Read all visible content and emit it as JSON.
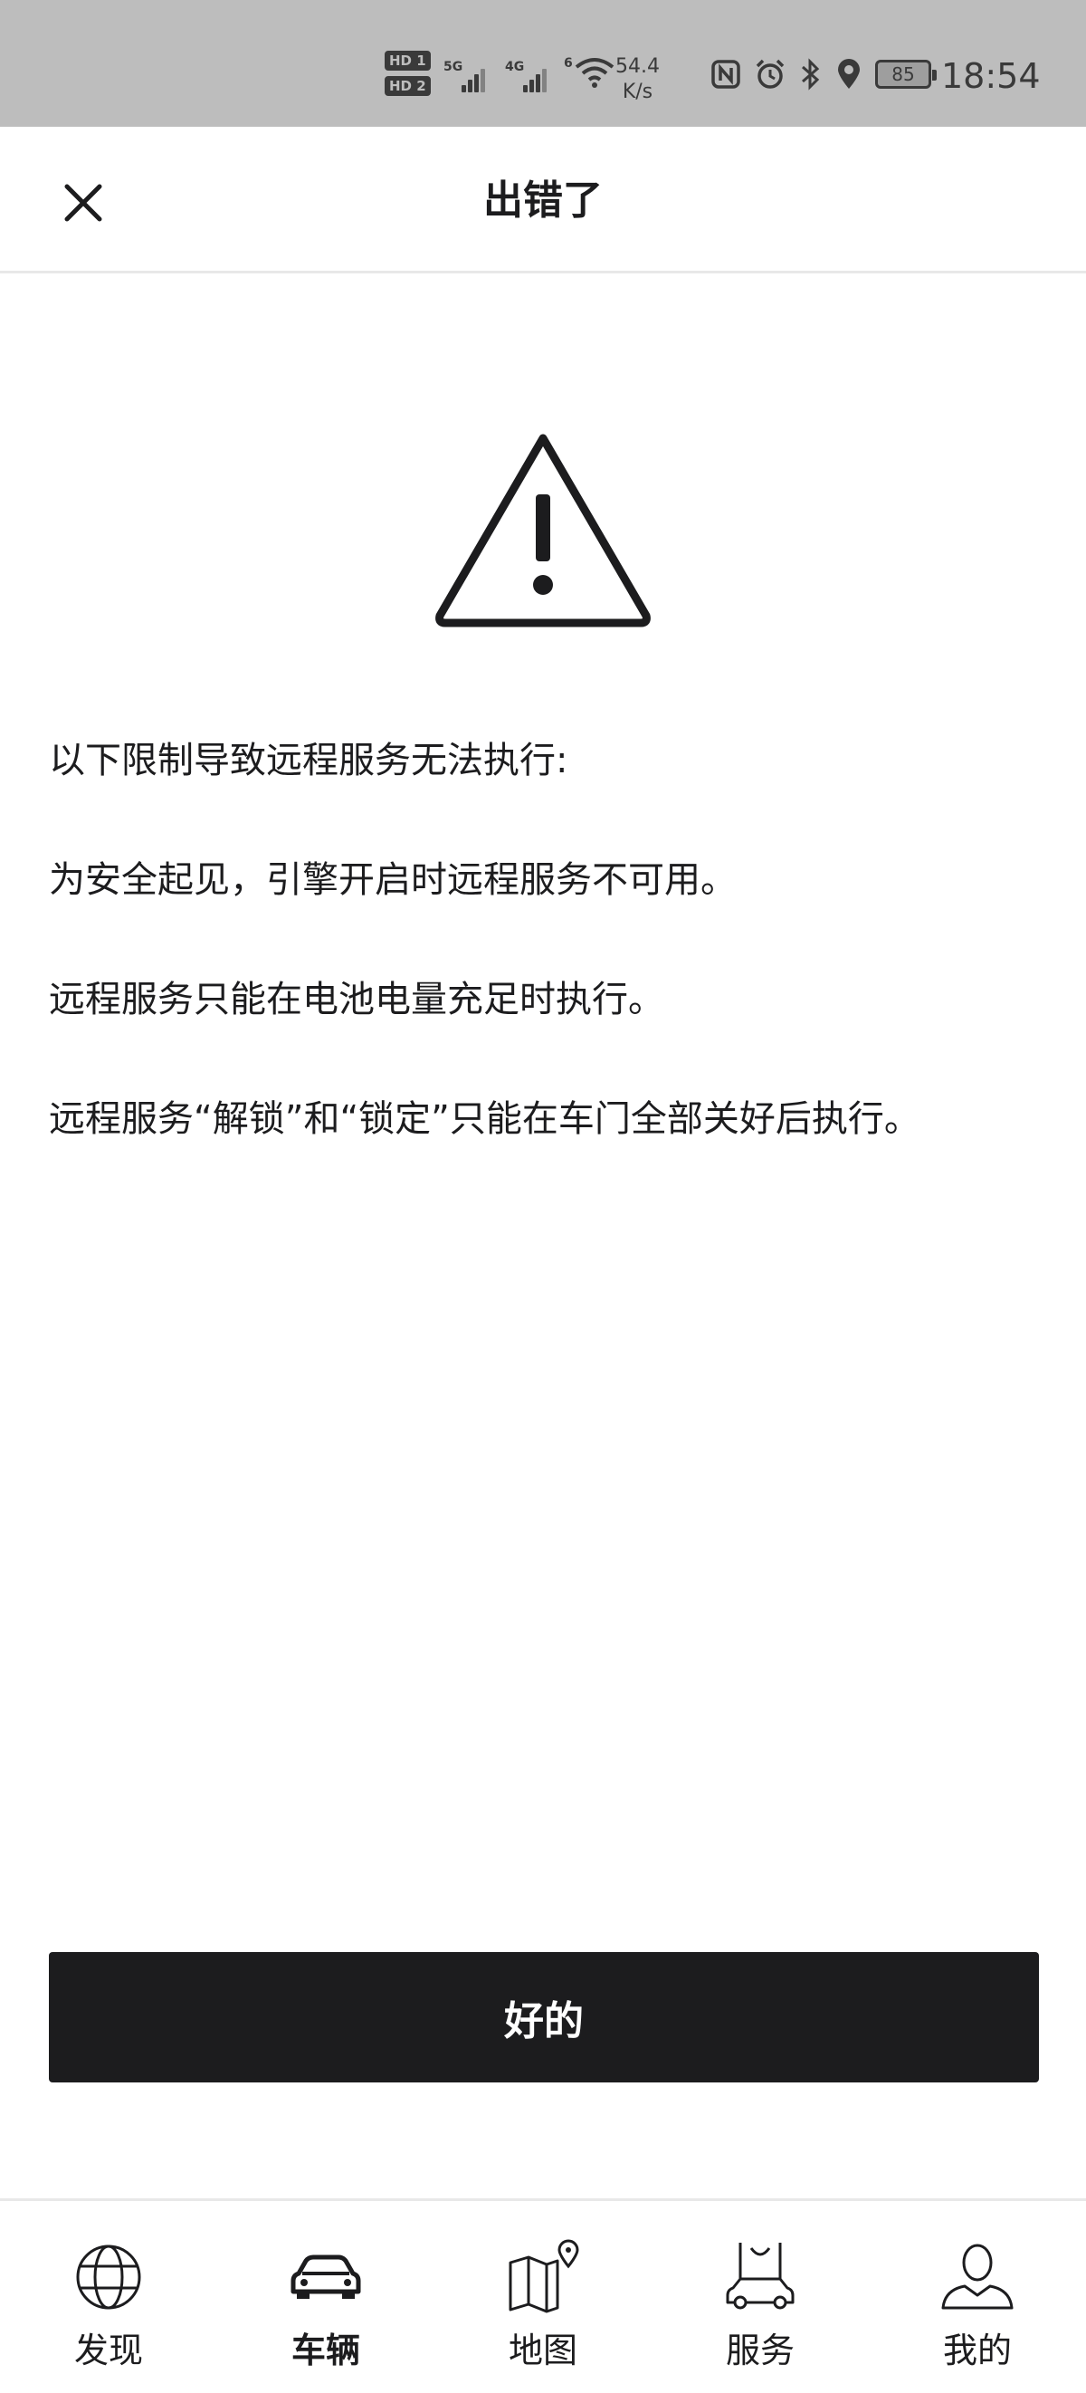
{
  "statusbar": {
    "hd1": "HD 1",
    "hd2": "HD 2",
    "sim1": "5G",
    "sim2": "4G",
    "wifi_tag": "6",
    "speed_value": "54.4",
    "speed_unit": "K/s",
    "battery": "85",
    "time": "18:54",
    "icons": [
      "nfc-icon",
      "alarm-icon",
      "bluetooth-icon",
      "location-icon"
    ]
  },
  "header": {
    "title": "出错了",
    "close_icon": "close-icon"
  },
  "warning_icon": "warning-triangle-icon",
  "message": {
    "intro": "以下限制导致远程服务无法执行:",
    "items": [
      "为安全起见，引擎开启时远程服务不可用。",
      "远程服务只能在电池电量充足时执行。",
      "远程服务“解锁”和“锁定”只能在车门全部关好后执行。"
    ]
  },
  "actions": {
    "ok_label": "好的"
  },
  "bottom_nav": {
    "items": [
      {
        "label": "发现",
        "icon": "globe-icon",
        "active": false
      },
      {
        "label": "车辆",
        "icon": "car-icon",
        "active": true
      },
      {
        "label": "地图",
        "icon": "map-icon",
        "active": false
      },
      {
        "label": "服务",
        "icon": "service-bag-icon",
        "active": false
      },
      {
        "label": "我的",
        "icon": "user-icon",
        "active": false
      }
    ]
  }
}
